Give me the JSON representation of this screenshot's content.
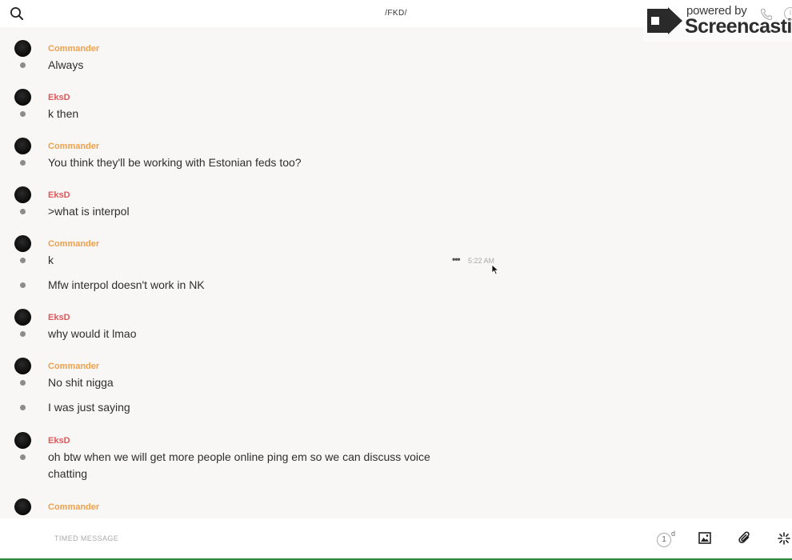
{
  "header": {
    "channel_title": "/FKD/"
  },
  "watermark": {
    "powered_by": "powered by",
    "brand": "Screencastify"
  },
  "colors": {
    "commander": "#f0a04b",
    "eksd": "#e0585a",
    "accent_bottom": "#2d8a3c"
  },
  "messages": [
    {
      "author": "Commander",
      "author_color": "#f0a04b",
      "lines": [
        "Always"
      ]
    },
    {
      "author": "EksD",
      "author_color": "#e0585a",
      "lines": [
        "k then"
      ]
    },
    {
      "author": "Commander",
      "author_color": "#f0a04b",
      "lines": [
        "You think they'll be working with Estonian feds too?"
      ]
    },
    {
      "author": "EksD",
      "author_color": "#e0585a",
      "lines": [
        ">what is interpol"
      ]
    },
    {
      "author": "Commander",
      "author_color": "#f0a04b",
      "lines": [
        "k",
        "Mfw interpol doesn't work in NK"
      ],
      "hover_time": "5:22 AM",
      "hover_actions": "•••"
    },
    {
      "author": "EksD",
      "author_color": "#e0585a",
      "lines": [
        "why would it lmao"
      ]
    },
    {
      "author": "Commander",
      "author_color": "#f0a04b",
      "lines": [
        "No shit nigga",
        "I was just saying"
      ]
    },
    {
      "author": "EksD",
      "author_color": "#e0585a",
      "lines": [
        "oh btw when we will get more people online ping em so we can discuss voice chatting"
      ]
    },
    {
      "author": "Commander",
      "author_color": "#f0a04b",
      "lines": []
    }
  ],
  "composer": {
    "placeholder": "TIMED MESSAGE",
    "timer_value": "1",
    "timer_unit": "d"
  },
  "icons": {
    "search": "search-icon",
    "phone": "phone-icon",
    "info": "info-icon",
    "image": "image-icon",
    "attach": "paperclip-icon",
    "extra": "sparkle-icon"
  }
}
